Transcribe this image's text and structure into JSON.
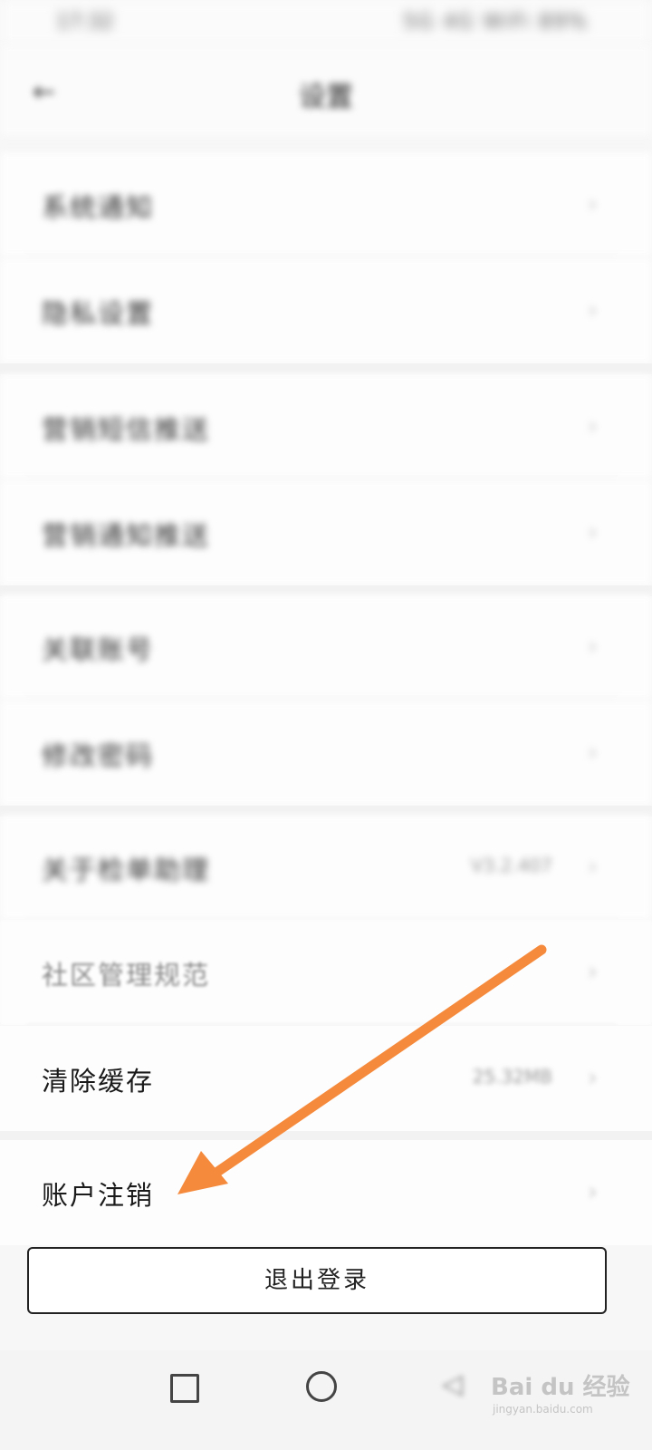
{
  "status_bar": {
    "time": "17:32",
    "indicators": "5G 4G WiFi 89%"
  },
  "header": {
    "title": "设置",
    "back_icon": "back-arrow-icon"
  },
  "rows": [
    {
      "label": "系统通知",
      "value": ""
    },
    {
      "label": "隐私设置",
      "value": ""
    },
    {
      "label": "营销短信推送",
      "value": ""
    },
    {
      "label": "营销通知推送",
      "value": ""
    },
    {
      "label": "关联账号",
      "value": ""
    },
    {
      "label": "修改密码",
      "value": ""
    },
    {
      "label": "关于检单助理",
      "value": "V3.2.407"
    },
    {
      "label": "社区管理规范",
      "value": ""
    },
    {
      "label": "清除缓存",
      "value": "25.32MB"
    },
    {
      "label": "账户注销",
      "value": ""
    }
  ],
  "logout": {
    "label": "退出登录"
  },
  "watermark": {
    "text": "Bai du 经验",
    "sub": "jingyan.baidu.com"
  },
  "colors": {
    "annotation_arrow": "#f58a3c",
    "button_border": "#222222"
  }
}
